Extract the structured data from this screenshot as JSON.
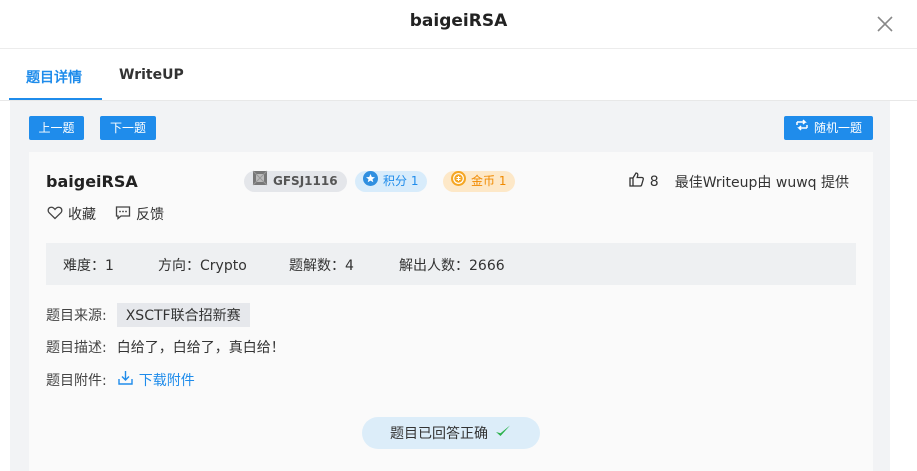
{
  "dialog": {
    "title": "baigeiRSA"
  },
  "tabs": [
    {
      "label": "题目详情"
    },
    {
      "label": "WriteUP"
    }
  ],
  "toolbar": {
    "prev_label": "上一题",
    "next_label": "下一题",
    "random_label": "随机一题"
  },
  "challenge": {
    "name": "baigeiRSA",
    "id_badge": "GFSJ1116",
    "score_badge": "积分 1",
    "coin_badge": "金币 1",
    "like_count": "8",
    "best_writeup": "最佳Writeup由 wuwq 提供",
    "favorite_label": "收藏",
    "feedback_label": "反馈"
  },
  "stats": {
    "difficulty": "难度：1",
    "direction": "方向：Crypto",
    "solve_count": "题解数：4",
    "solver_count": "解出人数：2666"
  },
  "meta": {
    "source_label": "题目来源:",
    "source_value": "XSCTF联合招新赛",
    "description_label": "题目描述:",
    "description_value": "白给了，白给了，真白给！",
    "attachment_label": "题目附件:",
    "download_label": "下载附件"
  },
  "status": {
    "solved_label": "题目已回答正确"
  },
  "colors": {
    "accent": "#1f8ceb",
    "coin": "#f08a00",
    "success": "#2bb24c"
  },
  "icons": [
    "close-icon",
    "shuffle-icon",
    "chip-icon",
    "star-icon",
    "coin-icon",
    "thumbs-up-icon",
    "heart-icon",
    "chat-icon",
    "download-icon",
    "checkmark-icon"
  ]
}
